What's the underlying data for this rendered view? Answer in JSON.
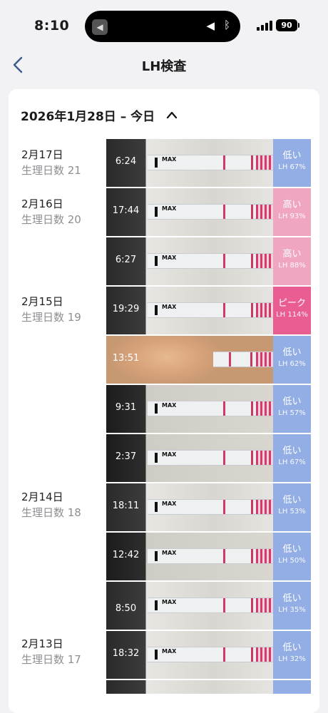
{
  "status": {
    "time": "8:10",
    "battery": "90"
  },
  "nav": {
    "title": "LH検査"
  },
  "range": {
    "label": "2026年1月28日 – 今日"
  },
  "days": [
    {
      "date": "2月17日",
      "cycle": "生理日数 21"
    },
    {
      "date": "2月16日",
      "cycle": "生理日数 20"
    },
    {
      "date": "2月15日",
      "cycle": "生理日数 19"
    },
    {
      "date": "2月14日",
      "cycle": "生理日数 18"
    },
    {
      "date": "2月13日",
      "cycle": "生理日数 17"
    }
  ],
  "tests": [
    {
      "time": "6:24",
      "level": "低い",
      "lh": "LH 67%"
    },
    {
      "time": "17:44",
      "level": "高い",
      "lh": "LH 93%"
    },
    {
      "time": "6:27",
      "level": "高い",
      "lh": "LH 88%"
    },
    {
      "time": "19:29",
      "level": "ピーク",
      "lh": "LH 114%"
    },
    {
      "time": "13:51",
      "level": "低い",
      "lh": "LH 62%"
    },
    {
      "time": "9:31",
      "level": "低い",
      "lh": "LH 57%"
    },
    {
      "time": "2:37",
      "level": "低い",
      "lh": "LH 67%"
    },
    {
      "time": "18:11",
      "level": "低い",
      "lh": "LH 53%"
    },
    {
      "time": "12:42",
      "level": "低い",
      "lh": "LH 50%"
    },
    {
      "time": "8:50",
      "level": "低い",
      "lh": "LH 35%"
    },
    {
      "time": "18:32",
      "level": "低い",
      "lh": "LH 32%"
    }
  ],
  "strip_label": "MAX",
  "colors": {
    "low": "#93aee4",
    "high": "#f0a6c3",
    "peak": "#ea5d93"
  }
}
